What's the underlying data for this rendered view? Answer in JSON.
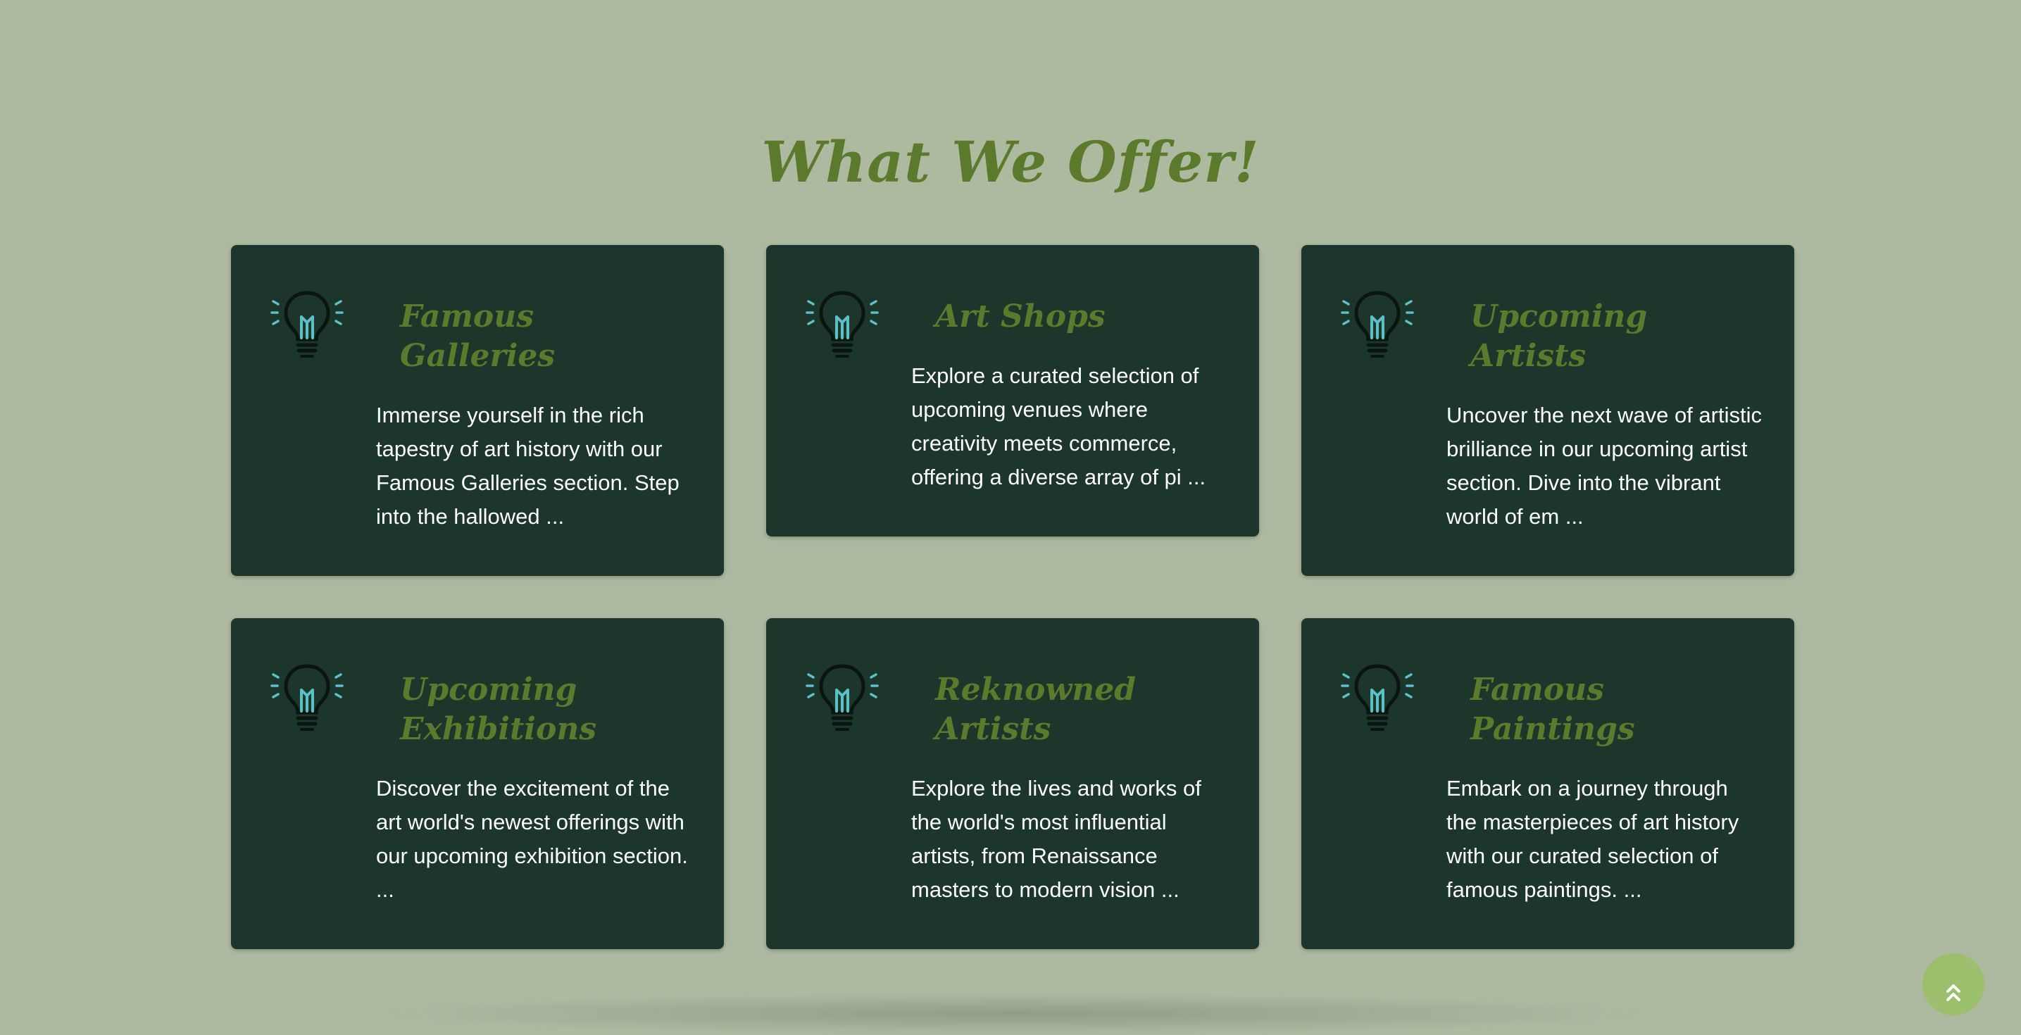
{
  "section": {
    "title": "What We Offer!"
  },
  "colors": {
    "background": "#adbaa0",
    "card": "#1c362b",
    "accent": "#5c7a2c",
    "icon_rays": "#5bc0c8",
    "scroll_button": "#9cbf6e"
  },
  "cards": [
    {
      "icon": "lightbulb-icon",
      "title": "Famous Galleries",
      "text": "Immerse yourself in the rich tapestry of art history with our Famous Galleries section. Step into the hallowed ..."
    },
    {
      "icon": "lightbulb-icon",
      "title": "Art Shops",
      "text": "Explore a curated selection of upcoming venues where creativity meets commerce, offering a diverse array of pi ..."
    },
    {
      "icon": "lightbulb-icon",
      "title": "Upcoming Artists",
      "text": "Uncover the next wave of artistic brilliance in our upcoming artist section. Dive into the vibrant world of em ..."
    },
    {
      "icon": "lightbulb-icon",
      "title": "Upcoming Exhibitions",
      "text": "Discover the excitement of the art world's newest offerings with our upcoming exhibition section. ..."
    },
    {
      "icon": "lightbulb-icon",
      "title": "Reknowned Artists",
      "text": "Explore the lives and works of the world's most influential artists, from Renaissance masters to modern vision ..."
    },
    {
      "icon": "lightbulb-icon",
      "title": "Famous Paintings",
      "text": "Embark on a journey through the masterpieces of art history with our curated selection of famous paintings. ..."
    }
  ],
  "scroll_top": {
    "icon": "double-chevron-up-icon"
  }
}
